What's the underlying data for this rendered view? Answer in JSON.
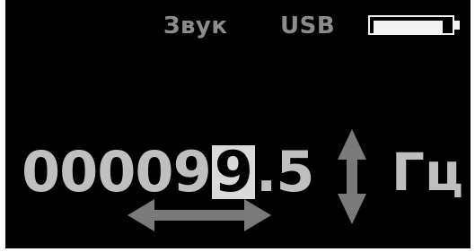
{
  "status": {
    "sound_label": "Звук",
    "usb_label": "USB",
    "battery_icon": "battery-icon",
    "battery_level": 0.92
  },
  "frequency": {
    "digits": [
      "0",
      "0",
      "0",
      "0",
      "9",
      "9",
      ".",
      "5"
    ],
    "cursor_index": 5,
    "unit": "Гц"
  },
  "controls": {
    "horizontal_arrow_icon": "left-right-arrow-icon",
    "vertical_arrow_icon": "up-down-arrow-icon"
  },
  "colors": {
    "background": "#000000",
    "text": "#bfbfbf",
    "dim_text": "#8c8c8c",
    "arrow": "#7a7a7a",
    "cursor_bg": "#d9d9d9"
  }
}
